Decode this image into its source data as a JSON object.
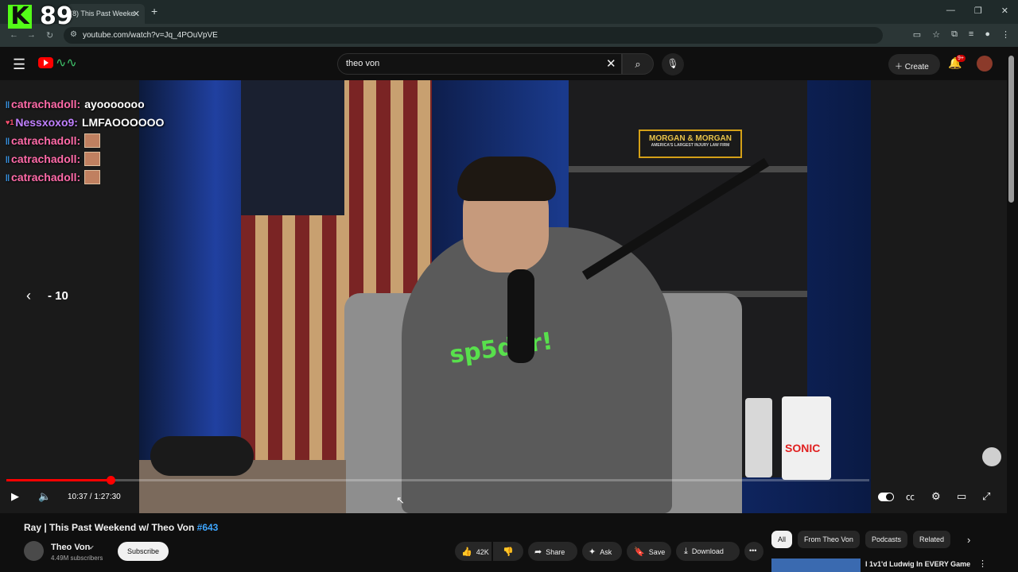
{
  "browser": {
    "tab_title": "(8) This Past Weeke",
    "tab_close": "✕",
    "new_tab": "+",
    "url": "youtube.com/watch?v=Jq_4POuVpVE",
    "window_controls": [
      "—",
      "❐",
      "✕"
    ]
  },
  "overlay": {
    "kick_logo": "K",
    "viewer_count": "89"
  },
  "header": {
    "search_value": "theo von",
    "create_label": "Create",
    "notification_badge": "9+"
  },
  "chat": [
    {
      "user": "catrachadoll:",
      "message": "ayooooooo",
      "user_color": "#ff6aa8",
      "badge": "||"
    },
    {
      "user": "Nessxoxo9:",
      "message": "LMFAOOOOOO",
      "user_color": "#c080ff",
      "badge": "♥1"
    },
    {
      "user": "catrachadoll:",
      "message": "",
      "user_color": "#ff6aa8",
      "badge": "||",
      "emote": "face-emote"
    },
    {
      "user": "catrachadoll:",
      "message": "",
      "user_color": "#ff6aa8",
      "badge": "||",
      "emote": "face-emote"
    },
    {
      "user": "catrachadoll:",
      "message": "",
      "user_color": "#ff6aa8",
      "badge": "||",
      "emote": "face-emote"
    }
  ],
  "player": {
    "skip_label": "- 10",
    "time": "10:37 / 1:27:30",
    "progress_fraction": 0.121,
    "sign_text": "MORGAN & MORGAN",
    "sign_subtext": "AMERICA'S LARGEST INJURY LAW FIRM",
    "hoodie_text": "sp5der!",
    "cup_text": "SONIC"
  },
  "video": {
    "title": "Ray | This Past Weekend w/ Theo Von",
    "episode_tag": "#643",
    "channel": "Theo Von",
    "subscribers": "4.49M subscribers",
    "subscribe_label": "Subscribe",
    "likes": "42K",
    "share_label": "Share",
    "ask_label": "Ask",
    "save_label": "Save",
    "download_label": "Download"
  },
  "chips": [
    "All",
    "From Theo Von",
    "Podcasts",
    "Related"
  ],
  "recommendation": {
    "title": "I 1v1'd Ludwig In EVERY Game"
  },
  "colors": {
    "accent_red": "#ff0000",
    "kick_green": "#53fc18",
    "link_blue": "#3ea6ff"
  }
}
